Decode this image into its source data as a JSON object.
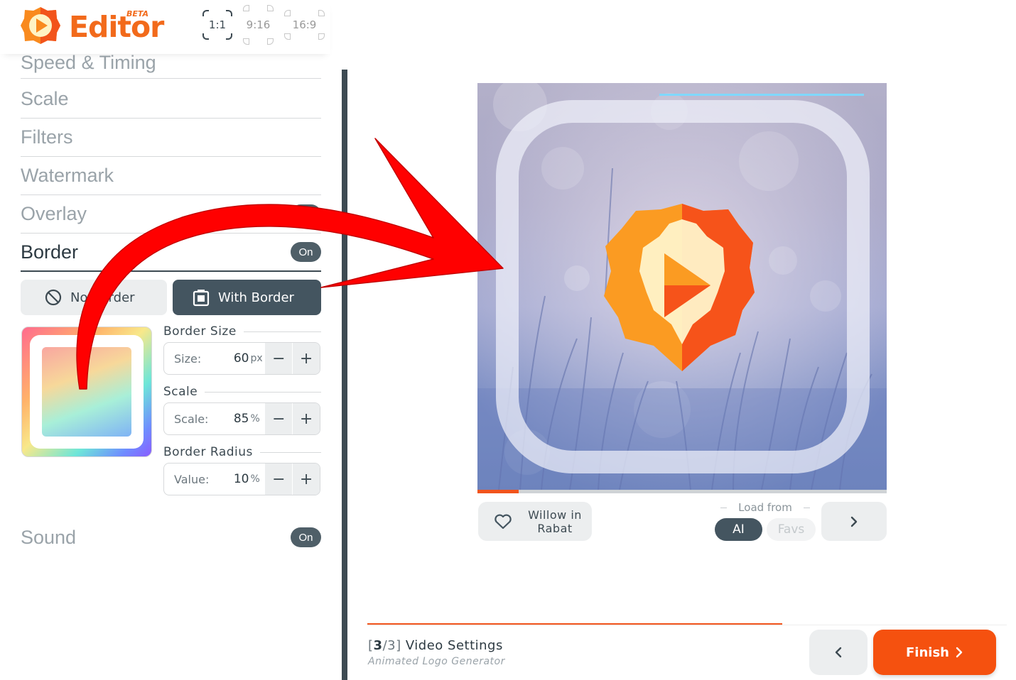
{
  "header": {
    "app_name": "Editor",
    "badge": "BETA",
    "ratios": [
      {
        "label": "1:1",
        "active": true
      },
      {
        "label": "9:16",
        "active": false
      },
      {
        "label": "16:9",
        "active": false
      }
    ]
  },
  "sidebar": {
    "sections": [
      {
        "label": "Speed & Timing"
      },
      {
        "label": "Scale"
      },
      {
        "label": "Filters"
      },
      {
        "label": "Watermark"
      },
      {
        "label": "Overlay"
      },
      {
        "label": "Border",
        "toggle": "On",
        "active": true
      }
    ],
    "border_options": {
      "no_border": "No Border",
      "with_border": "With Border",
      "selected": "with_border"
    },
    "border_size": {
      "heading": "Border Size",
      "label": "Size:",
      "value": "60",
      "unit": "px"
    },
    "scale": {
      "heading": "Scale",
      "label": "Scale:",
      "value": "85",
      "unit": "%"
    },
    "border_radius": {
      "heading": "Border Radius",
      "label": "Value:",
      "value": "10",
      "unit": "%"
    },
    "sound": {
      "label": "Sound",
      "toggle": "On"
    }
  },
  "stage": {
    "progress_fraction": 0.1,
    "top_progress_fraction": 0.1
  },
  "tools": {
    "favorite_name": "Willow in Rabat",
    "load_from_label": "Load from",
    "sources": [
      "AI",
      "Favs"
    ],
    "selected_source": "AI"
  },
  "footer": {
    "step_current": "3",
    "step_total": "3",
    "step_title": "Video Settings",
    "step_subtitle": "Animated Logo Generator",
    "finish_label": "Finish"
  },
  "colors": {
    "accent": "#f26a1b",
    "dark": "#445560",
    "finish": "#f5510f",
    "annotation_arrow": "#ff0000"
  },
  "icons": [
    "logo-icon",
    "no-border-icon",
    "frame-icon",
    "heart-icon",
    "chevron-right-icon",
    "chevron-left-icon",
    "minus-icon",
    "plus-icon"
  ]
}
